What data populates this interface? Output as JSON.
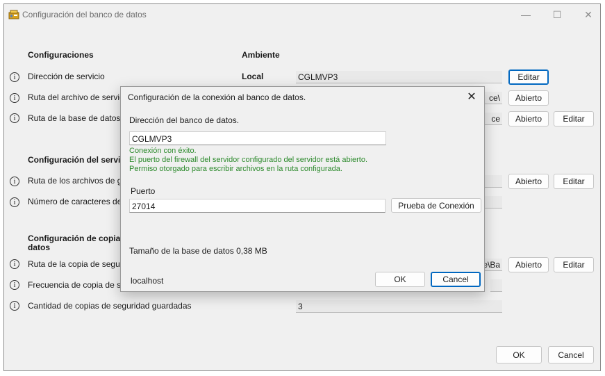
{
  "window": {
    "title": "Configuración del banco de datos"
  },
  "headers": {
    "settings": "Configuraciones",
    "environment": "Ambiente"
  },
  "rows": {
    "service_address": {
      "label": "Dirección de servicio",
      "env": "Local",
      "value": "CGLMVP3",
      "btn": "Editar"
    },
    "service_file_path": {
      "label": "Ruta del archivo de servicio",
      "value_tail": "ce\\",
      "btn": "Abierto"
    },
    "database_path": {
      "label": "Ruta de la base de datos (",
      "value_tail": "ce",
      "btn_open": "Abierto",
      "btn_edit": "Editar"
    }
  },
  "section_service": {
    "title": "Configuración del servi"
  },
  "rows_service": {
    "record_files_path": {
      "label": "Ruta de los archivos de gr",
      "btn_open": "Abierto",
      "btn_edit": "Editar"
    },
    "char_count": {
      "label": "Número de caracteres del r"
    }
  },
  "section_backup": {
    "title_line1": "Configuración de copia",
    "title_line2": "datos"
  },
  "rows_backup": {
    "backup_path": {
      "label": "Ruta de la copia de segurid",
      "value_tail": "ce\\Ba",
      "btn_open": "Abierto",
      "btn_edit": "Editar"
    },
    "backup_frequency": {
      "label": "Frecuencia de copia de seg"
    },
    "backup_count": {
      "label": "Cantidad de copias de seguridad guardadas",
      "value": "3"
    }
  },
  "footer": {
    "ok": "OK",
    "cancel": "Cancel"
  },
  "dialog": {
    "title": "Configuración de la conexión al banco de datos.",
    "address_label": "Dirección del banco de datos.",
    "address_value": "CGLMVP3",
    "status_1": "Conexión con éxito.",
    "status_2": "El puerto del firewall del servidor configurado del servidor está abierto.",
    "status_3": "Permiso otorgado para escribir archivos en la ruta configurada.",
    "port_label": "Puerto",
    "port_value": "27014",
    "test_button": "Prueba de Conexión",
    "db_size": "Tamaño de la base de datos 0,38 MB",
    "host": "localhost",
    "ok": "OK",
    "cancel": "Cancel"
  },
  "icons": {
    "info": "i",
    "close": "✕",
    "minimize": "—",
    "maximize": "☐"
  }
}
